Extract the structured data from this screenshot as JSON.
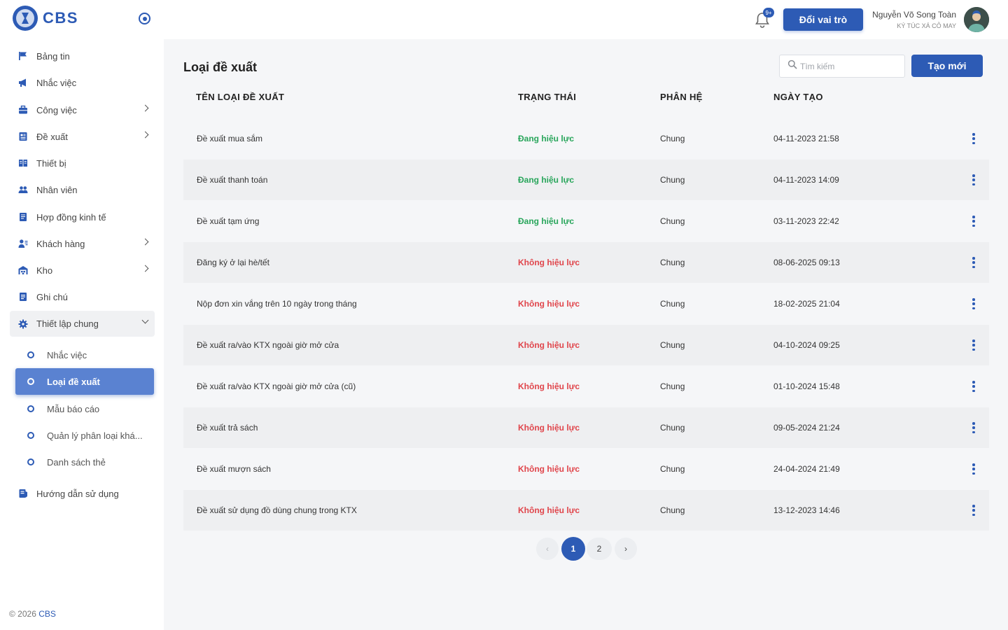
{
  "brand": {
    "name": "CBS"
  },
  "sidebar": {
    "items": [
      {
        "label": "Bảng tin",
        "icon": "flag-icon"
      },
      {
        "label": "Nhắc việc",
        "icon": "megaphone-icon"
      },
      {
        "label": "Công việc",
        "icon": "briefcase-icon",
        "has_children": true
      },
      {
        "label": "Đề xuất",
        "icon": "document-icon",
        "has_children": true
      },
      {
        "label": "Thiết bị",
        "icon": "book-icon"
      },
      {
        "label": "Nhân viên",
        "icon": "users-icon"
      },
      {
        "label": "Hợp đồng kinh tế",
        "icon": "contract-icon"
      },
      {
        "label": "Khách hàng",
        "icon": "customer-icon",
        "has_children": true
      },
      {
        "label": "Kho",
        "icon": "warehouse-icon",
        "has_children": true
      },
      {
        "label": "Ghi chú",
        "icon": "note-icon"
      },
      {
        "label": "Thiết lập chung",
        "icon": "gear-icon",
        "expanded": true
      }
    ],
    "sub_items": [
      {
        "label": "Nhắc việc"
      },
      {
        "label": "Loại đề xuất",
        "active": true
      },
      {
        "label": "Mẫu báo cáo"
      },
      {
        "label": "Quản lý phân loại khá..."
      },
      {
        "label": "Danh sách thẻ"
      }
    ],
    "guide": {
      "label": "Hướng dẫn sử dụng",
      "icon": "guide-icon"
    },
    "footer_prefix": "© 2026",
    "footer_brand": "CBS"
  },
  "header": {
    "notification_badge": "9+",
    "role_button": "Đổi vai trò",
    "user_name": "Nguyễn Võ Song Toàn",
    "user_org": "KÝ TÚC XÁ CỎ MAY"
  },
  "main": {
    "title": "Loại đề xuất",
    "search_placeholder": "Tìm kiếm",
    "create_button": "Tạo mới",
    "columns": [
      "TÊN LOẠI ĐỀ XUẤT",
      "TRẠNG THÁI",
      "PHÂN HỆ",
      "NGÀY TẠO"
    ],
    "rows": [
      {
        "name": "Đề xuất mua sắm",
        "status": "Đang hiệu lực",
        "active": true,
        "module": "Chung",
        "created": "04-11-2023 21:58"
      },
      {
        "name": "Đề xuất thanh toán",
        "status": "Đang hiệu lực",
        "active": true,
        "module": "Chung",
        "created": "04-11-2023 14:09"
      },
      {
        "name": "Đề xuất tạm ứng",
        "status": "Đang hiệu lực",
        "active": true,
        "module": "Chung",
        "created": "03-11-2023 22:42"
      },
      {
        "name": "Đăng ký ở lại hè/tết",
        "status": "Không hiệu lực",
        "active": false,
        "module": "Chung",
        "created": "08-06-2025 09:13"
      },
      {
        "name": "Nộp đơn xin vắng trên 10 ngày trong tháng",
        "status": "Không hiệu lực",
        "active": false,
        "module": "Chung",
        "created": "18-02-2025 21:04"
      },
      {
        "name": "Đề xuất ra/vào KTX ngoài giờ mở cửa",
        "status": "Không hiệu lực",
        "active": false,
        "module": "Chung",
        "created": "04-10-2024 09:25"
      },
      {
        "name": "Đề xuất ra/vào KTX ngoài giờ mở cửa (cũ)",
        "status": "Không hiệu lực",
        "active": false,
        "module": "Chung",
        "created": "01-10-2024 15:48"
      },
      {
        "name": "Đề xuất trả sách",
        "status": "Không hiệu lực",
        "active": false,
        "module": "Chung",
        "created": "09-05-2024 21:24"
      },
      {
        "name": "Đề xuất mượn sách",
        "status": "Không hiệu lực",
        "active": false,
        "module": "Chung",
        "created": "24-04-2024 21:49"
      },
      {
        "name": "Đề xuất sử dụng đồ dùng chung trong KTX",
        "status": "Không hiệu lực",
        "active": false,
        "module": "Chung",
        "created": "13-12-2023 14:46"
      }
    ],
    "pagination": {
      "pages": [
        "1",
        "2"
      ],
      "current": "1",
      "prev": "‹",
      "next": "›"
    }
  },
  "colors": {
    "primary": "#2d5bb5",
    "active_status": "#27a55a",
    "inactive_status": "#e0454b",
    "active_menu": "#5a82d1"
  }
}
